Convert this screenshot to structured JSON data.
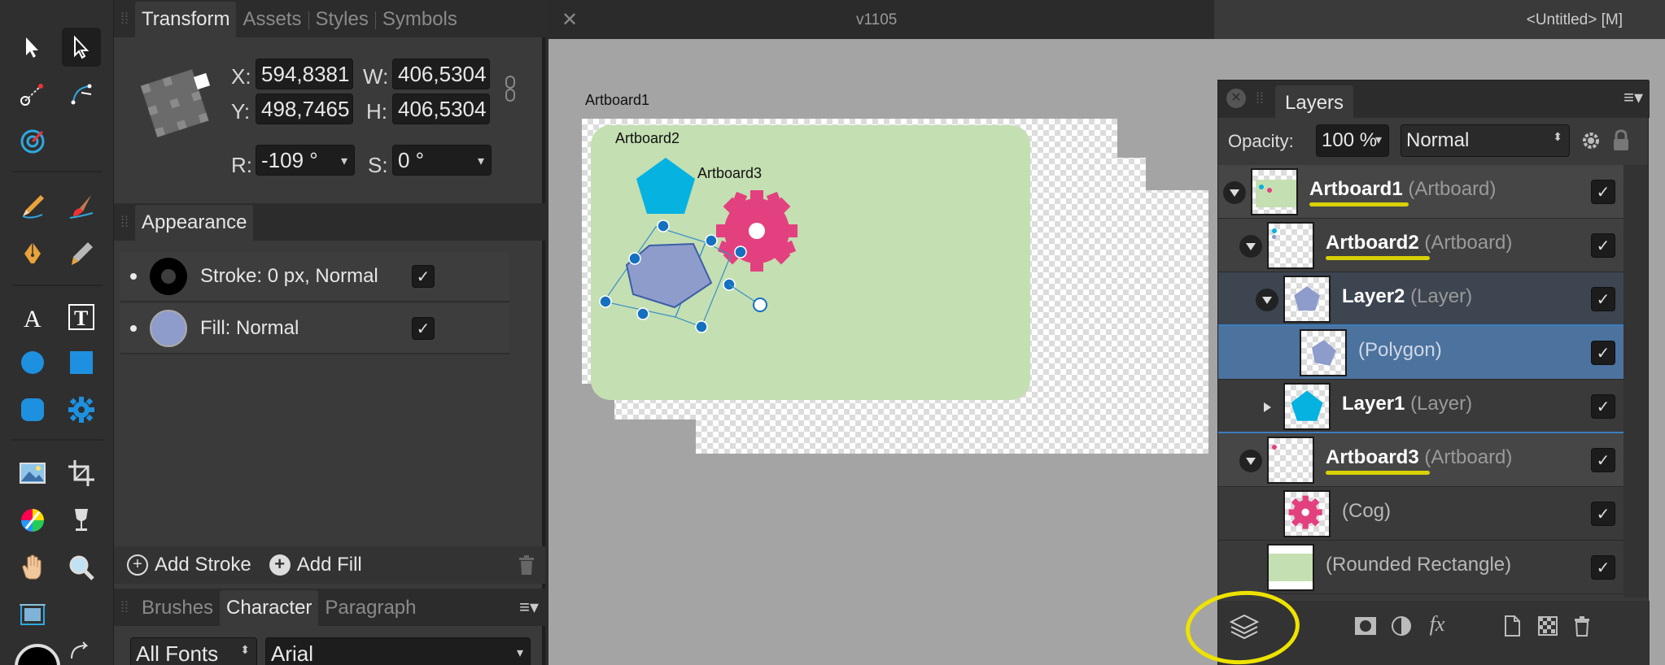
{
  "document": {
    "version_label": "v1105",
    "title": "<Untitled> [M]"
  },
  "transform_panel": {
    "tabs": [
      "Transform",
      "Assets",
      "Styles",
      "Symbols"
    ],
    "x_label": "X:",
    "x_value": "594,8381",
    "y_label": "Y:",
    "y_value": "498,7465",
    "w_label": "W:",
    "w_value": "406,5304",
    "h_label": "H:",
    "h_value": "406,5304",
    "r_label": "R:",
    "r_value": "-109 °",
    "s_label": "S:",
    "s_value": "0 °"
  },
  "appearance_panel": {
    "tab": "Appearance",
    "stroke_label": "Stroke: 0 px, Normal",
    "fill_label": "Fill: Normal",
    "add_stroke": "Add Stroke",
    "add_fill": "Add Fill"
  },
  "text_panel": {
    "tabs": [
      "Brushes",
      "Character",
      "Paragraph"
    ],
    "font_collection": "All Fonts",
    "font_family": "Arial"
  },
  "canvas": {
    "artboard1_label": "Artboard1",
    "artboard2_label": "Artboard2",
    "artboard3_label": "Artboard3"
  },
  "layers_panel": {
    "tab": "Layers",
    "opacity_label": "Opacity:",
    "opacity_value": "100 %",
    "blend_mode": "Normal",
    "rows": [
      {
        "name": "Artboard1",
        "type": "(Artboard)"
      },
      {
        "name": "Artboard2",
        "type": "(Artboard)"
      },
      {
        "name": "Layer2",
        "type": "(Layer)"
      },
      {
        "name": "",
        "type": "(Polygon)"
      },
      {
        "name": "Layer1",
        "type": "(Layer)"
      },
      {
        "name": "Artboard3",
        "type": "(Artboard)"
      },
      {
        "name": "",
        "type": "(Cog)"
      },
      {
        "name": "",
        "type": "(Rounded Rectangle)"
      }
    ]
  },
  "colors": {
    "artboard_green": "#c4dfb2",
    "pentagon_cyan": "#05b2e0",
    "polygon_lavender": "#8e9ccc",
    "cog_pink": "#e3407f",
    "selection_blue": "#4c729e",
    "highlight_yellow": "#eee300"
  }
}
